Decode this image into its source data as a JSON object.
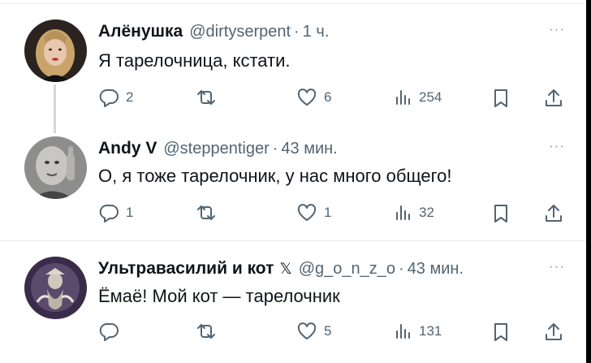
{
  "tweets": [
    {
      "name": "Алёнушка",
      "handle": "@dirtyserpent",
      "time": "1 ч.",
      "text": "Я тарелочница, кстати.",
      "more": "···",
      "replies": "2",
      "retweets": "",
      "likes": "6",
      "views": "254"
    },
    {
      "name": "Andy V",
      "handle": "@steppentiger",
      "time": "43 мин.",
      "text": "О, я тоже тарелочник, у нас много общего!",
      "more": "···",
      "replies": "1",
      "retweets": "",
      "likes": "1",
      "views": "32"
    },
    {
      "name": "Ультравасилий и кот",
      "badge": "𝕏",
      "handle": "@g_o_n_z_o",
      "time": "43 мин.",
      "text": "Ёмаё! Мой кот — тарелочник",
      "more": "···",
      "replies": "",
      "retweets": "",
      "likes": "5",
      "views": "131"
    }
  ],
  "icons": [
    "reply-icon",
    "retweet-icon",
    "like-icon",
    "views-icon",
    "bookmark-icon",
    "share-icon"
  ],
  "colors": {
    "text": "#0f1419",
    "secondary": "#536471",
    "thread_line": "#cfd9de"
  }
}
